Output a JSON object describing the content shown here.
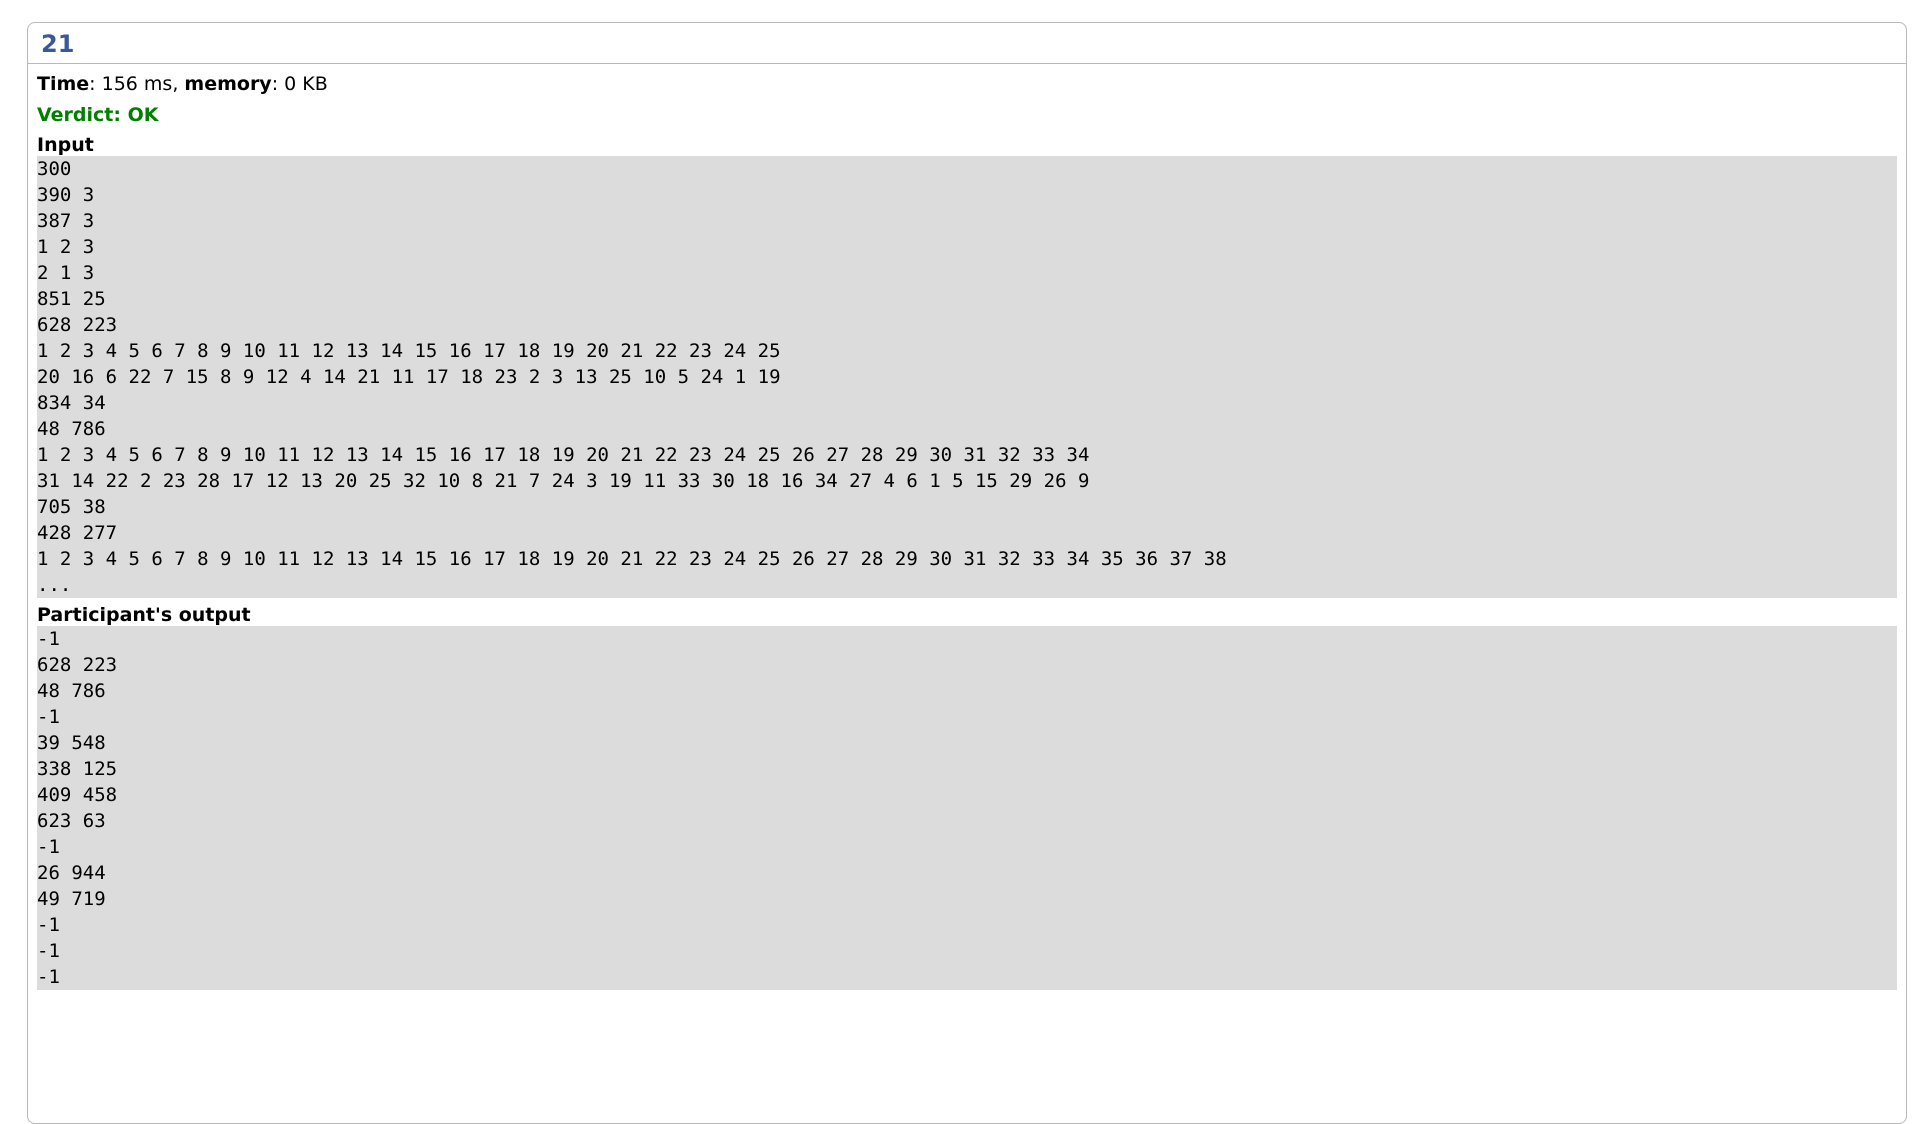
{
  "test": {
    "number": "21",
    "time_label": "Time",
    "time_value": ": 156 ms, ",
    "memory_label": "memory",
    "memory_value": ": 0 KB",
    "verdict": "Verdict: OK",
    "verdict_color": "#008000",
    "number_color": "#3b5998"
  },
  "input": {
    "title": "Input",
    "lines": [
      "300",
      "390 3",
      "387 3",
      "1 2 3",
      "2 1 3",
      "851 25",
      "628 223",
      "1 2 3 4 5 6 7 8 9 10 11 12 13 14 15 16 17 18 19 20 21 22 23 24 25",
      "20 16 6 22 7 15 8 9 12 4 14 21 11 17 18 23 2 3 13 25 10 5 24 1 19",
      "834 34",
      "48 786",
      "1 2 3 4 5 6 7 8 9 10 11 12 13 14 15 16 17 18 19 20 21 22 23 24 25 26 27 28 29 30 31 32 33 34",
      "31 14 22 2 23 28 17 12 13 20 25 32 10 8 21 7 24 3 19 11 33 30 18 16 34 27 4 6 1 5 15 29 26 9",
      "705 38",
      "428 277",
      "1 2 3 4 5 6 7 8 9 10 11 12 13 14 15 16 17 18 19 20 21 22 23 24 25 26 27 28 29 30 31 32 33 34 35 36 37 38",
      "..."
    ]
  },
  "output": {
    "title": "Participant's output",
    "lines": [
      "-1",
      "628 223",
      "48 786",
      "-1",
      "39 548",
      "338 125",
      "409 458",
      "623 63",
      "-1",
      "26 944",
      "49 719",
      "-1",
      "-1",
      "-1"
    ]
  }
}
